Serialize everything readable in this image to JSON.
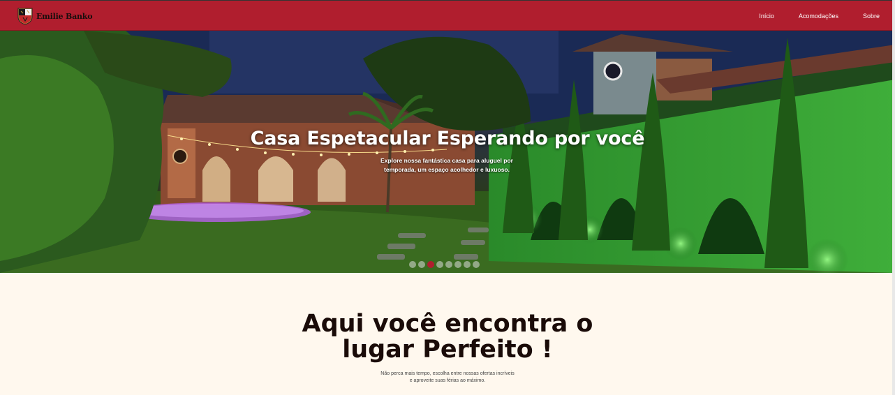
{
  "navbar": {
    "brand_name": "Emilie Banko",
    "links": [
      "Início",
      "Acomodações",
      "Sobre"
    ]
  },
  "hero": {
    "title": "Casa Espetacular Esperando por você",
    "subtitle_lines": [
      "Explore nossa fantástica casa para aluguel por",
      "temporada, um espaço acolhedor e luxuoso."
    ],
    "slide_count": 8,
    "active_slide": 3
  },
  "main": {
    "headline_lines": [
      "Aqui você encontra o",
      "lugar Perfeito !"
    ],
    "subline_lines": [
      "Não perca mais tempo, escolha entre nossas ofertas incríveis",
      "e aproveite suas férias ao máximo."
    ]
  },
  "colors": {
    "navbar": "#b01e2e",
    "background": "#fff8ee",
    "heading": "#1a0b08"
  }
}
